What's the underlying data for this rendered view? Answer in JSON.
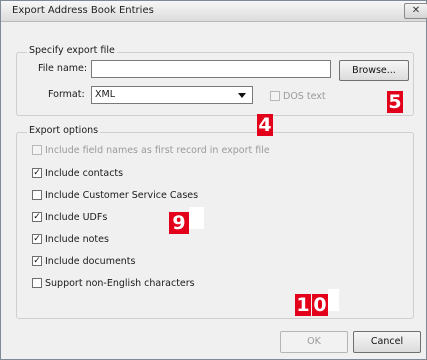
{
  "window": {
    "title": "Export Address Book Entries",
    "close_glyph": "✕"
  },
  "export_file": {
    "group_label": "Specify export file",
    "file_name_label": "File name:",
    "file_name_value": "",
    "browse_label": "Browse...",
    "format_label": "Format:",
    "format_value": "XML",
    "dos_text_label": "DOS text",
    "dos_text_checked": false
  },
  "export_options": {
    "group_label": "Export options",
    "options": [
      {
        "label": "Include field names as first record in export file",
        "checked": false,
        "enabled": false
      },
      {
        "label": "Include contacts",
        "checked": true,
        "enabled": true
      },
      {
        "label": "Include Customer Service Cases",
        "checked": false,
        "enabled": true
      },
      {
        "label": "Include UDFs",
        "checked": true,
        "enabled": true
      },
      {
        "label": "Include notes",
        "checked": true,
        "enabled": true
      },
      {
        "label": "Include documents",
        "checked": true,
        "enabled": true
      },
      {
        "label": "Support non-English characters",
        "checked": false,
        "enabled": true
      }
    ]
  },
  "buttons": {
    "ok_label": "OK",
    "cancel_label": "Cancel"
  },
  "callouts": {
    "badge_4": "4",
    "badge_5": "5",
    "badge_9": "9",
    "badge_10_a": "1",
    "badge_10_b": "0"
  },
  "colors": {
    "callout_red": "#e3001b",
    "dialog_bg": "#f0f0f0"
  }
}
